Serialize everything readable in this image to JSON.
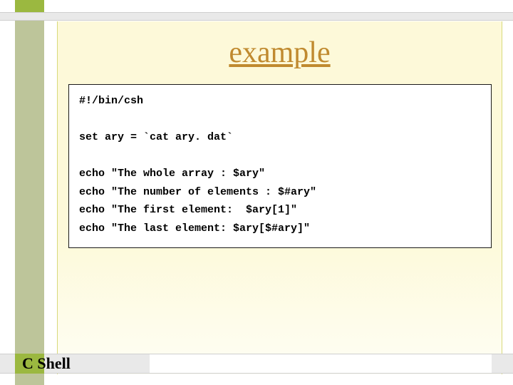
{
  "title": "example",
  "code": "#!/bin/csh\n\nset ary = `cat ary. dat`\n\necho \"The whole array : $ary\"\necho \"The number of elements : $#ary\"\necho \"The first element:  $ary[1]\"\necho \"The last element: $ary[$#ary]\"",
  "footer": "C Shell"
}
